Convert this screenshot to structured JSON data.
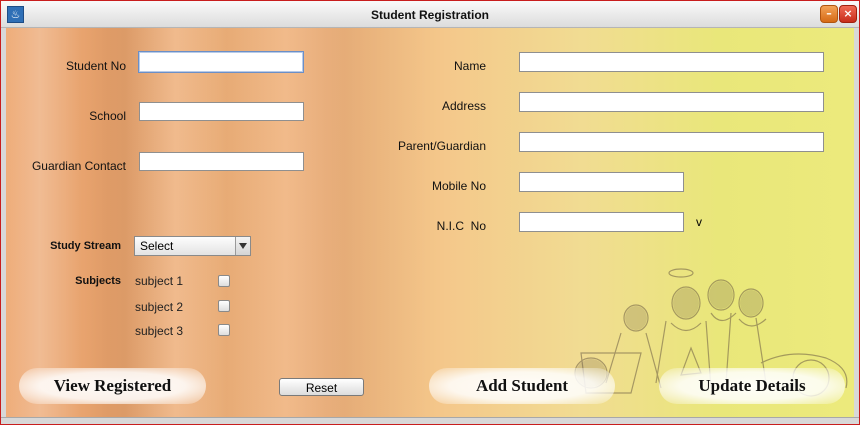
{
  "window": {
    "title": "Student Registration",
    "icon": "java-cup-icon",
    "minimize_icon": "minimize-icon",
    "close_icon": "close-icon",
    "border_color": "#c81d1d"
  },
  "form": {
    "left": {
      "student_no_label": "Student No",
      "school_label": "School",
      "guardian_contact_label": "Guardian Contact",
      "student_no_value": "",
      "school_value": "",
      "guardian_contact_value": ""
    },
    "right": {
      "name_label": "Name",
      "address_label": "Address",
      "parent_label": "Parent/Guardian",
      "mobile_label": "Mobile No",
      "nic_label": "N.I.C  No",
      "nic_suffix": "v",
      "name_value": "",
      "address_value": "",
      "parent_value": "",
      "mobile_value": "",
      "nic_value": ""
    },
    "study_stream": {
      "label": "Study Stream",
      "selected": "Select"
    },
    "subjects": {
      "label": "Subjects",
      "items": [
        {
          "label": "subject 1",
          "checked": false
        },
        {
          "label": "subject 2",
          "checked": false
        },
        {
          "label": "subject 3",
          "checked": false
        }
      ]
    }
  },
  "buttons": {
    "view_registered": "View Registered",
    "reset": "Reset",
    "add_student": "Add Student",
    "update_details": "Update Details"
  },
  "background": {
    "illustration": "students-sketch"
  }
}
